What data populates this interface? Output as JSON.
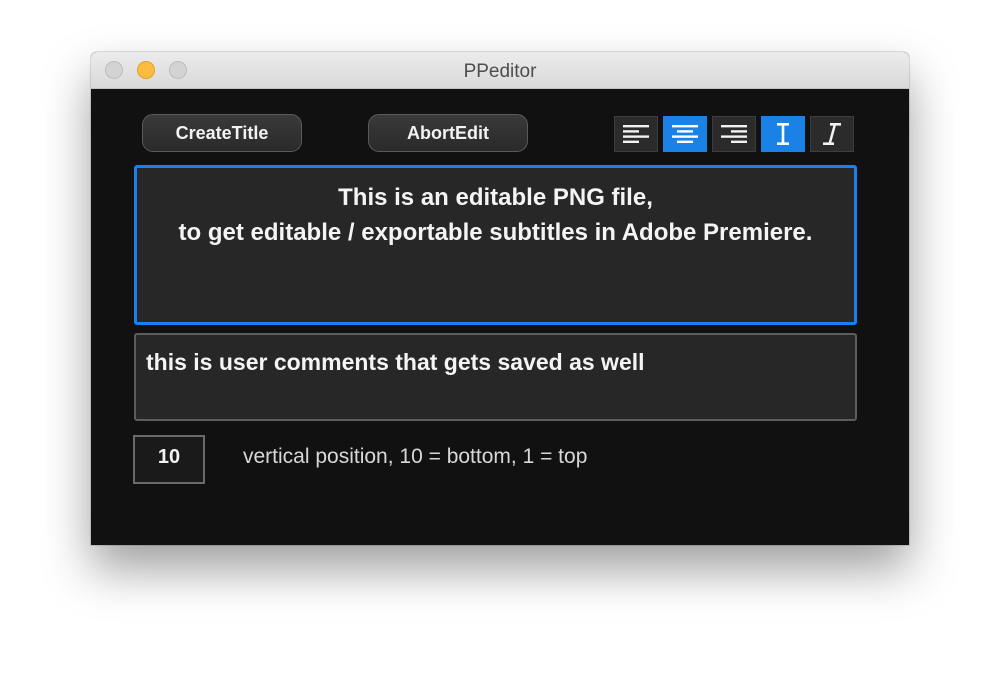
{
  "window": {
    "title": "PPeditor"
  },
  "toolbar": {
    "create_title_label": "CreateTitle",
    "abort_edit_label": "AbortEdit",
    "tools": [
      {
        "name": "align-left",
        "icon": "align-left-icon",
        "active": false
      },
      {
        "name": "align-center",
        "icon": "align-center-icon",
        "active": true
      },
      {
        "name": "align-right",
        "icon": "align-right-icon",
        "active": false
      },
      {
        "name": "text-upright",
        "icon": "text-upright-icon",
        "active": true
      },
      {
        "name": "text-italic",
        "icon": "text-italic-icon",
        "active": false
      }
    ]
  },
  "title_editor": {
    "line1": "This is an editable PNG file,",
    "line2": "to get editable / exportable subtitles in Adobe Premiere."
  },
  "comment_editor": {
    "text": "this is user comments that gets saved as well"
  },
  "position": {
    "value": "10",
    "label": "vertical position, 10 = bottom, 1 = top"
  },
  "colors": {
    "accent": "#1a82e6",
    "background": "#111111",
    "field": "#272727",
    "minimize": "#fdbc40"
  }
}
